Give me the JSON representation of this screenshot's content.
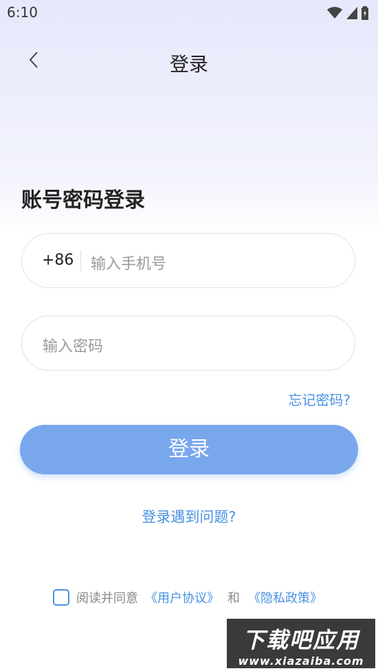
{
  "status": {
    "time": "6:10"
  },
  "header": {
    "title": "登录"
  },
  "section_title": "账号密码登录",
  "phone": {
    "prefix": "+86",
    "placeholder": "输入手机号"
  },
  "password": {
    "placeholder": "输入密码"
  },
  "forgot_label": "忘记密码?",
  "login_label": "登录",
  "problem_label": "登录遇到问题?",
  "agreement": {
    "prefix": "阅读并同意",
    "user_agreement": "《用户协议》",
    "and": "和",
    "privacy": "《隐私政策》"
  },
  "watermark": {
    "big": "下载吧应用",
    "small": "www.xiazaiba.com"
  },
  "colors": {
    "accent": "#4a90e2",
    "button": "#79a7ec"
  }
}
